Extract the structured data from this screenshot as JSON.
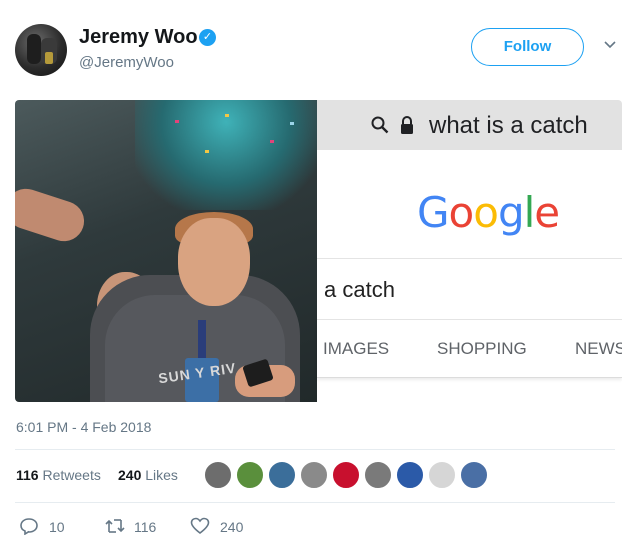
{
  "tweet": {
    "author_name": "Jeremy Woo",
    "author_handle": "@JeremyWoo",
    "follow_label": "Follow",
    "timestamp": "6:01 PM - 4 Feb 2018"
  },
  "media": {
    "shirt_text": "SUN  Y RIV",
    "screen": {
      "address_text": "what is a catch",
      "logo": [
        "G",
        "o",
        "o",
        "g",
        "l",
        "e"
      ],
      "logo_colors": [
        "#4285f4",
        "#ea4335",
        "#fbbc05",
        "#4285f4",
        "#34a853",
        "#ea4335"
      ],
      "search_query": "a catch",
      "tabs": [
        "IMAGES",
        "SHOPPING",
        "NEWS"
      ]
    }
  },
  "stats": {
    "retweets_count": "116",
    "retweets_label": "Retweets",
    "likes_count": "240",
    "likes_label": "Likes"
  },
  "likers": [
    {
      "name": "liker-avatar-1",
      "color": "#6d6d6d"
    },
    {
      "name": "liker-avatar-2",
      "color": "#5a8f3c"
    },
    {
      "name": "liker-avatar-3",
      "color": "#3b6e9a"
    },
    {
      "name": "liker-avatar-4",
      "color": "#8a8a8a"
    },
    {
      "name": "liker-avatar-5",
      "color": "#c8102e"
    },
    {
      "name": "liker-avatar-6",
      "color": "#7a7a7a"
    },
    {
      "name": "liker-avatar-7",
      "color": "#2b5aa8"
    },
    {
      "name": "liker-avatar-8",
      "color": "#d6d6d6"
    },
    {
      "name": "liker-avatar-9",
      "color": "#4a6fa5"
    }
  ],
  "actions": {
    "reply_count": "10",
    "retweet_count": "116",
    "like_count": "240"
  },
  "colors": {
    "accent": "#1da1f2",
    "muted": "#657786"
  }
}
